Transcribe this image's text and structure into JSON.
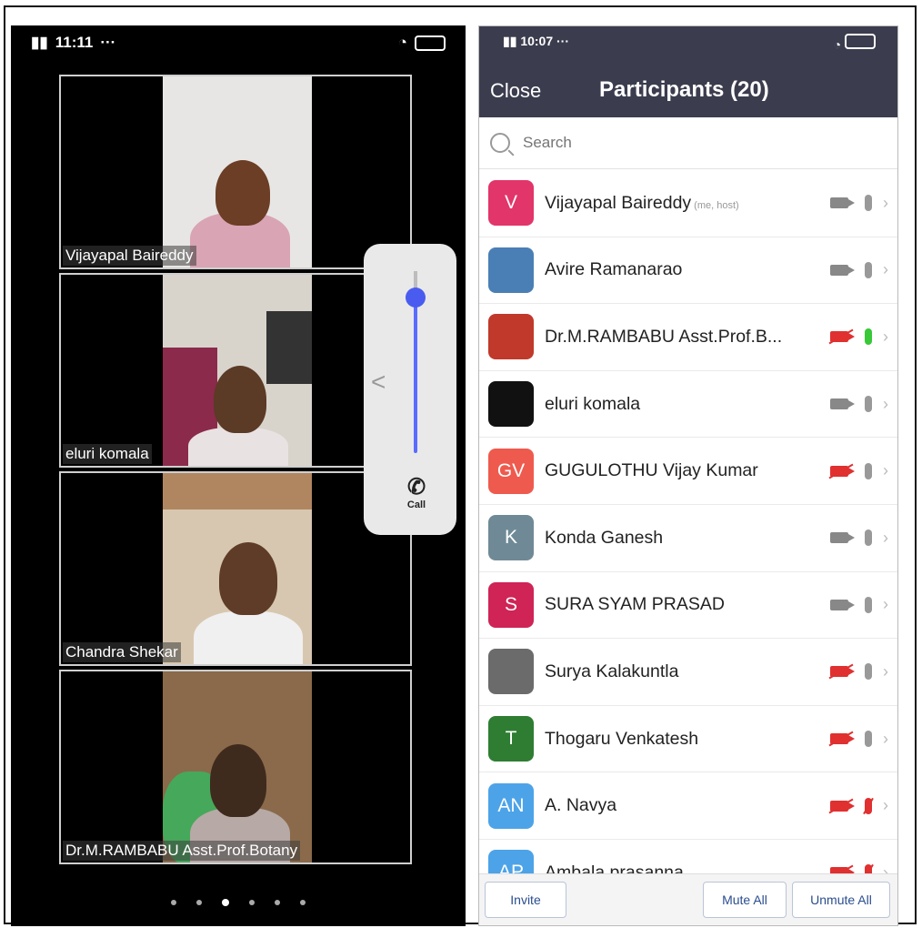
{
  "left_screen": {
    "status_time": "11:11",
    "tiles": [
      {
        "name": "Vijayapal Baireddy"
      },
      {
        "name": "eluri komala"
      },
      {
        "name": "Chandra Shekar"
      },
      {
        "name": "Dr.M.RAMBABU Asst.Prof.Botany"
      }
    ],
    "floating_panel": {
      "call_label": "Call"
    },
    "pager_count": 6,
    "pager_active": 2
  },
  "right_screen": {
    "status_time": "10:07",
    "close_label": "Close",
    "title": "Participants (20)",
    "search_placeholder": "Search",
    "participants": [
      {
        "initials": "V",
        "name": "Vijayapal Baireddy",
        "tag": "(me, host)",
        "avatar_color": "#e2356a",
        "video": "on",
        "audio": "idle"
      },
      {
        "initials": "",
        "name": "Avire Ramanarao",
        "tag": "",
        "avatar_color": "#4a7fb5",
        "video": "on",
        "audio": "idle"
      },
      {
        "initials": "",
        "name": "Dr.M.RAMBABU Asst.Prof.B...",
        "tag": "",
        "avatar_color": "#c0392b",
        "video": "off",
        "audio": "on"
      },
      {
        "initials": "",
        "name": "eluri komala",
        "tag": "",
        "avatar_color": "#111111",
        "video": "on",
        "audio": "idle"
      },
      {
        "initials": "GV",
        "name": "GUGULOTHU Vijay Kumar",
        "tag": "",
        "avatar_color": "#ef5a4e",
        "video": "off",
        "audio": "idle"
      },
      {
        "initials": "K",
        "name": "Konda Ganesh",
        "tag": "",
        "avatar_color": "#6f8a96",
        "video": "on",
        "audio": "idle"
      },
      {
        "initials": "S",
        "name": "SURA SYAM PRASAD",
        "tag": "",
        "avatar_color": "#cf2455",
        "video": "on",
        "audio": "idle"
      },
      {
        "initials": "",
        "name": "Surya Kalakuntla",
        "tag": "",
        "avatar_color": "#6b6b6b",
        "video": "off",
        "audio": "idle"
      },
      {
        "initials": "T",
        "name": "Thogaru Venkatesh",
        "tag": "",
        "avatar_color": "#2e7d32",
        "video": "off",
        "audio": "idle"
      },
      {
        "initials": "AN",
        "name": "A. Navya",
        "tag": "",
        "avatar_color": "#4da3e8",
        "video": "off",
        "audio": "muted"
      },
      {
        "initials": "AP",
        "name": "Ambala prasanna",
        "tag": "",
        "avatar_color": "#4da3e8",
        "video": "off",
        "audio": "muted"
      }
    ],
    "buttons": {
      "invite": "Invite",
      "mute_all": "Mute All",
      "unmute_all": "Unmute All"
    }
  }
}
